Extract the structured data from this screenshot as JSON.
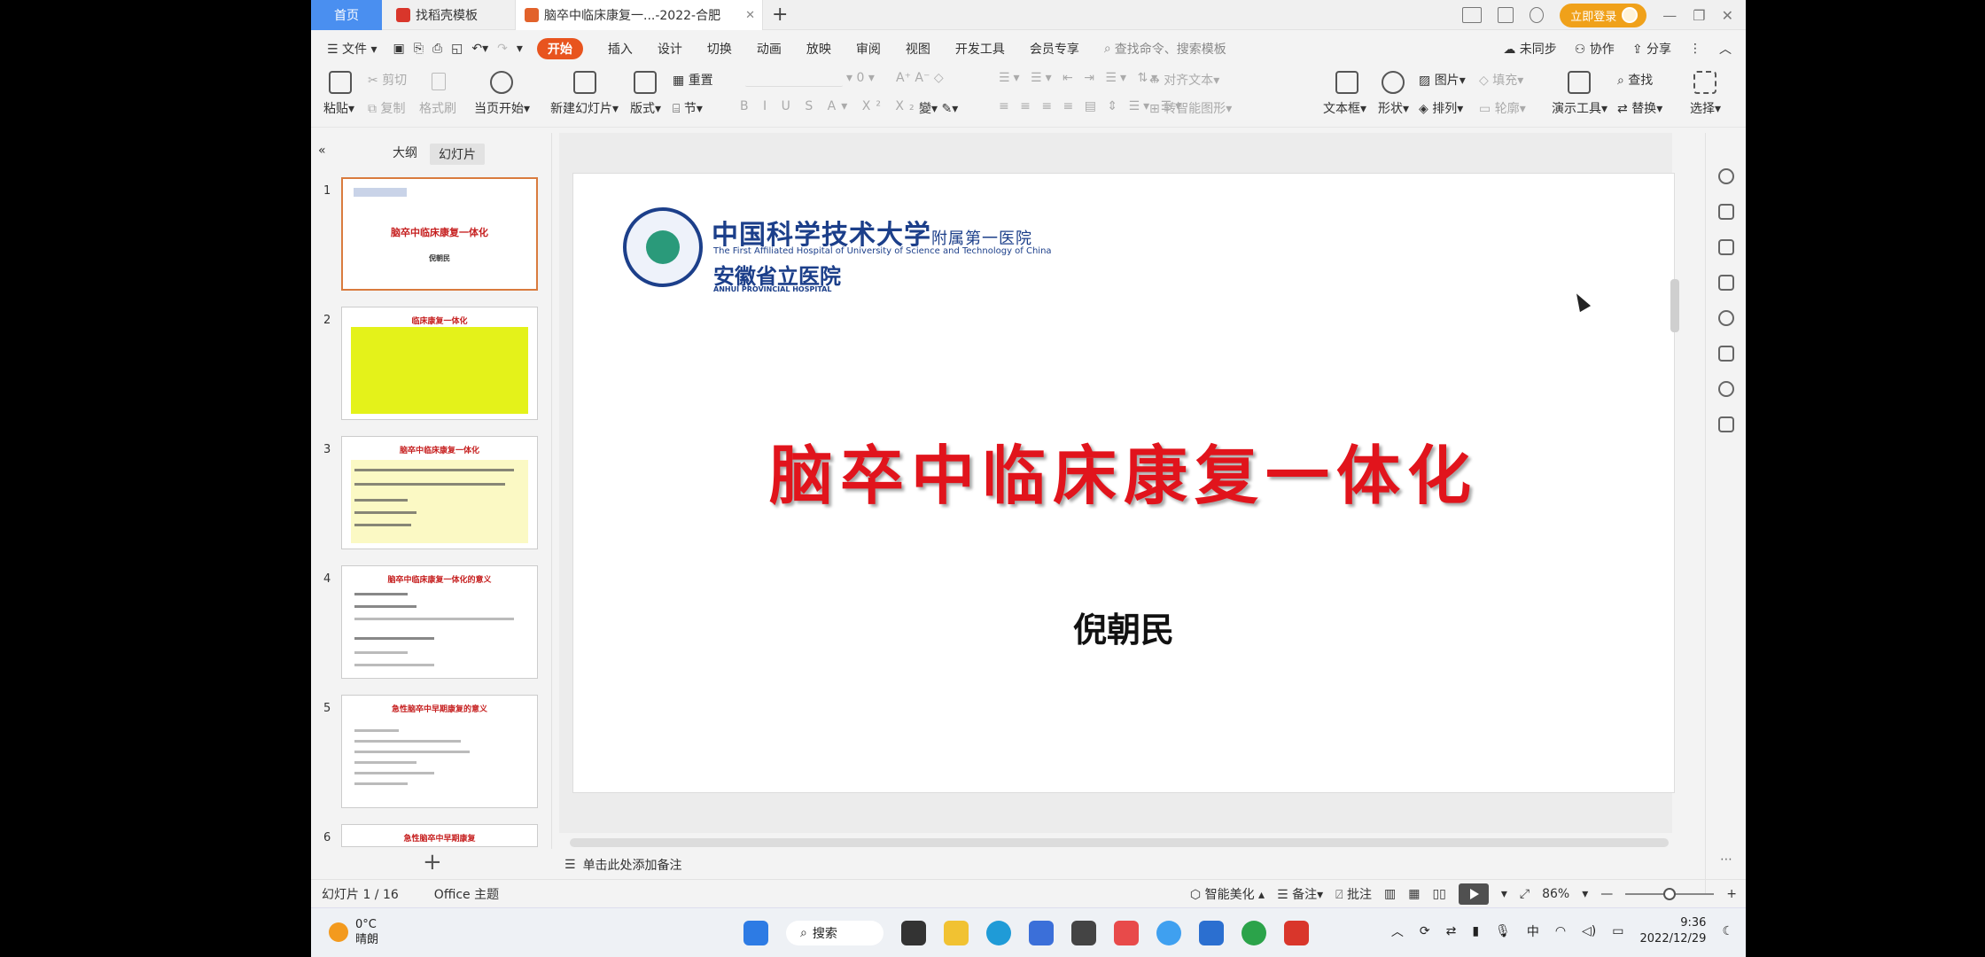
{
  "tabs": {
    "home": "首页",
    "template": "找稻壳模板",
    "document": "脑卒中临床康复一...-2022-合肥"
  },
  "title_bar": {
    "login": "立即登录"
  },
  "menu": {
    "file": "文件",
    "items": [
      "开始",
      "插入",
      "设计",
      "切换",
      "动画",
      "放映",
      "审阅",
      "视图",
      "开发工具",
      "会员专享"
    ],
    "search_placeholder": "查找命令、搜索模板",
    "sync": "未同步",
    "collab": "协作",
    "share": "分享"
  },
  "ribbon": {
    "paste": "粘贴",
    "cut": "剪切",
    "copy": "复制",
    "format_painter": "格式刷",
    "from_current": "当页开始",
    "new_slide": "新建幻灯片",
    "layout": "版式",
    "section": "节",
    "reset": "重置",
    "font_size": "0",
    "align_text": "对齐文本",
    "smart_graphic": "转智能图形",
    "textbox": "文本框",
    "shape": "形状",
    "picture": "图片",
    "arrange": "排列",
    "fill": "填充",
    "outline": "轮廓",
    "present_tools": "演示工具",
    "find": "查找",
    "replace": "替换",
    "select": "选择"
  },
  "left_panel": {
    "tab_outline": "大纲",
    "tab_slides": "幻灯片",
    "thumbs": [
      {
        "num": "1",
        "title": "脑卒中临床康复一体化",
        "sub": "倪朝民"
      },
      {
        "num": "2",
        "title": "临床康复一体化"
      },
      {
        "num": "3",
        "title": "脑卒中临床康复一体化"
      },
      {
        "num": "4",
        "title": "脑卒中临床康复一体化的意义"
      },
      {
        "num": "5",
        "title": "急性脑卒中早期康复的意义"
      },
      {
        "num": "6",
        "title": "急性脑卒中早期康复"
      }
    ]
  },
  "slide": {
    "logo_cn": "中国科学技术大学",
    "logo_cn_suffix": "附属第一医院",
    "logo_en": "The First Affiliated Hospital of University of Science and Technology of China",
    "logo_cn2": "安徽省立医院",
    "logo_en2": "ANHUI PROVINCIAL HOSPITAL",
    "title": "脑卒中临床康复一体化",
    "author": "倪朝民"
  },
  "notes_placeholder": "单击此处添加备注",
  "status": {
    "slide_pos": "幻灯片 1 / 16",
    "theme": "Office 主题",
    "smart_beautify": "智能美化",
    "notes": "备注",
    "comment": "批注",
    "zoom": "86%",
    "zoom_fraction": 0.5
  },
  "taskbar": {
    "temp": "0°C",
    "weather": "晴朗",
    "search": "搜索",
    "ime": "中",
    "time": "9:36",
    "date": "2022/12/29"
  }
}
